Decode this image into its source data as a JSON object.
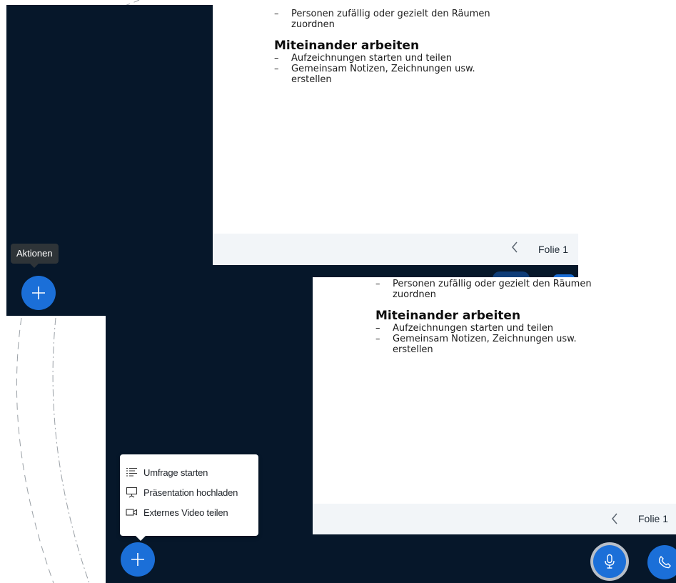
{
  "slide": {
    "bullet_assign_line1": "Personen zufällig oder gezielt den Räumen",
    "bullet_assign_line2": "zuordnen",
    "heading": "Miteinander arbeiten",
    "bullet_record": "Aufzeichnungen starten und teilen",
    "bullet_notes_line1": "Gemeinsam Notizen, Zeichnungen usw.",
    "bullet_notes_line2": "erstellen",
    "dash": "–"
  },
  "footer": {
    "slide_label": "Folie 1"
  },
  "actions": {
    "tooltip": "Aktionen"
  },
  "menu": {
    "items": [
      {
        "label": "Umfrage starten",
        "icon": "poll-icon"
      },
      {
        "label": "Präsentation hochladen",
        "icon": "presentation-icon"
      },
      {
        "label": "Externes Video teilen",
        "icon": "video-icon"
      }
    ]
  },
  "colors": {
    "background": "#06172a",
    "accent": "#1b6fd8",
    "tooltip": "#2e3438",
    "footer": "#f2f5f8"
  }
}
